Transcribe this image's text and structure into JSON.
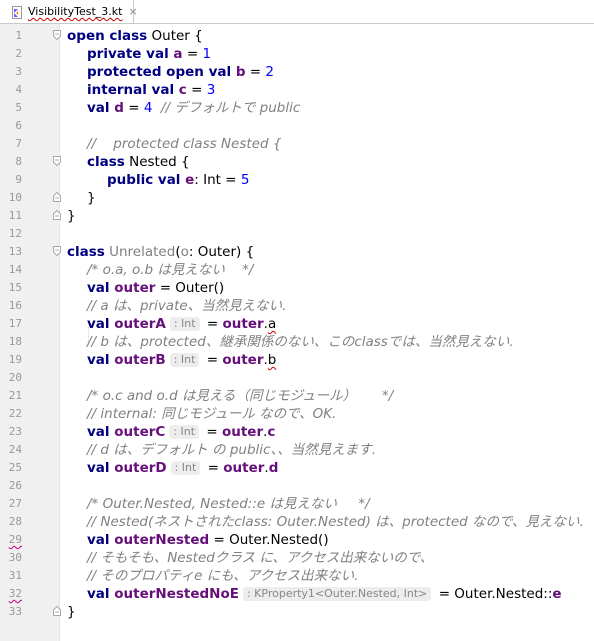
{
  "tab": {
    "title": "VisibilityTest_3.kt",
    "close": "×"
  },
  "editor": {
    "lines": [
      {
        "n": "1",
        "fold": "open",
        "indent": 0,
        "tokens": [
          {
            "t": "open class",
            "c": "kw"
          },
          {
            "t": " Outer {",
            "c": ""
          }
        ]
      },
      {
        "n": "2",
        "indent": 1,
        "tokens": [
          {
            "t": "private val",
            "c": "kw"
          },
          {
            "t": " a",
            "c": "prop"
          },
          {
            "t": " = ",
            "c": ""
          },
          {
            "t": "1",
            "c": "num"
          }
        ]
      },
      {
        "n": "3",
        "indent": 1,
        "tokens": [
          {
            "t": "protected open val",
            "c": "kw"
          },
          {
            "t": " b",
            "c": "prop"
          },
          {
            "t": " = ",
            "c": ""
          },
          {
            "t": "2",
            "c": "num"
          }
        ]
      },
      {
        "n": "4",
        "indent": 1,
        "tokens": [
          {
            "t": "internal val",
            "c": "kw"
          },
          {
            "t": " c",
            "c": "prop"
          },
          {
            "t": " = ",
            "c": ""
          },
          {
            "t": "3",
            "c": "num"
          }
        ]
      },
      {
        "n": "5",
        "indent": 1,
        "tokens": [
          {
            "t": "val",
            "c": "kw"
          },
          {
            "t": " d",
            "c": "prop"
          },
          {
            "t": " = ",
            "c": ""
          },
          {
            "t": "4",
            "c": "num"
          },
          {
            "t": "  // デフォルトで public",
            "c": "cmt"
          }
        ]
      },
      {
        "n": "6",
        "indent": 0,
        "tokens": []
      },
      {
        "n": "7",
        "indent": 1,
        "tokens": [
          {
            "t": "//    protected class Nested {",
            "c": "cmt"
          }
        ]
      },
      {
        "n": "8",
        "fold": "open",
        "indent": 1,
        "tokens": [
          {
            "t": "class",
            "c": "kw"
          },
          {
            "t": " Nested {",
            "c": ""
          }
        ]
      },
      {
        "n": "9",
        "indent": 2,
        "tokens": [
          {
            "t": "public val",
            "c": "kw"
          },
          {
            "t": " e",
            "c": "prop"
          },
          {
            "t": ": Int = ",
            "c": ""
          },
          {
            "t": "5",
            "c": "num"
          }
        ]
      },
      {
        "n": "10",
        "fold": "close",
        "indent": 1,
        "tokens": [
          {
            "t": "}",
            "c": ""
          }
        ]
      },
      {
        "n": "11",
        "fold": "close",
        "indent": 0,
        "tokens": [
          {
            "t": "}",
            "c": ""
          }
        ]
      },
      {
        "n": "12",
        "indent": 0,
        "tokens": []
      },
      {
        "n": "13",
        "fold": "open",
        "indent": 0,
        "tokens": [
          {
            "t": "class",
            "c": "kw"
          },
          {
            "t": " ",
            "c": ""
          },
          {
            "t": "Unrelated",
            "c": "gray"
          },
          {
            "t": "(",
            "c": ""
          },
          {
            "t": "o",
            "c": "gray"
          },
          {
            "t": ": Outer) {",
            "c": ""
          }
        ]
      },
      {
        "n": "14",
        "indent": 1,
        "tokens": [
          {
            "t": "/* o.a, o.b は見えない    */",
            "c": "cmt"
          }
        ]
      },
      {
        "n": "15",
        "indent": 1,
        "tokens": [
          {
            "t": "val",
            "c": "kw"
          },
          {
            "t": " outer",
            "c": "prop"
          },
          {
            "t": " = Outer()",
            "c": ""
          }
        ]
      },
      {
        "n": "16",
        "indent": 1,
        "tokens": [
          {
            "t": "// a は、private、当然見えない.",
            "c": "cmt"
          }
        ]
      },
      {
        "n": "17",
        "indent": 1,
        "tokens": [
          {
            "t": "val",
            "c": "kw"
          },
          {
            "t": " outerA",
            "c": "prop"
          },
          {
            "t": ": Int",
            "c": "hint"
          },
          {
            "t": " = ",
            "c": ""
          },
          {
            "t": "outer",
            "c": "prop"
          },
          {
            "t": ".",
            "c": ""
          },
          {
            "t": "a",
            "c": "warn"
          }
        ]
      },
      {
        "n": "18",
        "indent": 1,
        "tokens": [
          {
            "t": "// b は、protected、継承関係のない、このclassでは、当然見えない.",
            "c": "cmt"
          }
        ]
      },
      {
        "n": "19",
        "indent": 1,
        "tokens": [
          {
            "t": "val",
            "c": "kw"
          },
          {
            "t": " outerB",
            "c": "prop"
          },
          {
            "t": ": Int",
            "c": "hint"
          },
          {
            "t": " = ",
            "c": ""
          },
          {
            "t": "outer",
            "c": "prop"
          },
          {
            "t": ".",
            "c": ""
          },
          {
            "t": "b",
            "c": "warn"
          }
        ]
      },
      {
        "n": "20",
        "indent": 0,
        "tokens": []
      },
      {
        "n": "21",
        "indent": 1,
        "tokens": [
          {
            "t": "/* o.c and o.d は見える（同じモジュール）      */",
            "c": "cmt"
          }
        ]
      },
      {
        "n": "22",
        "indent": 1,
        "tokens": [
          {
            "t": "// internal: 同じモジュール なので、OK.",
            "c": "cmt"
          }
        ]
      },
      {
        "n": "23",
        "indent": 1,
        "tokens": [
          {
            "t": "val",
            "c": "kw"
          },
          {
            "t": " outerC",
            "c": "prop"
          },
          {
            "t": ": Int",
            "c": "hint"
          },
          {
            "t": " = ",
            "c": ""
          },
          {
            "t": "outer",
            "c": "prop"
          },
          {
            "t": ".",
            "c": ""
          },
          {
            "t": "c",
            "c": "prop"
          }
        ]
      },
      {
        "n": "24",
        "indent": 1,
        "tokens": [
          {
            "t": "// d は、デフォルト の public、、当然見えます.",
            "c": "cmt"
          }
        ]
      },
      {
        "n": "25",
        "indent": 1,
        "tokens": [
          {
            "t": "val",
            "c": "kw"
          },
          {
            "t": " outerD",
            "c": "prop"
          },
          {
            "t": ": Int",
            "c": "hint"
          },
          {
            "t": " = ",
            "c": ""
          },
          {
            "t": "outer",
            "c": "prop"
          },
          {
            "t": ".",
            "c": ""
          },
          {
            "t": "d",
            "c": "prop"
          }
        ]
      },
      {
        "n": "26",
        "indent": 0,
        "tokens": []
      },
      {
        "n": "27",
        "indent": 1,
        "tokens": [
          {
            "t": "/* Outer.Nested, Nested::e は見えない     */",
            "c": "cmt"
          }
        ]
      },
      {
        "n": "28",
        "indent": 1,
        "tokens": [
          {
            "t": "// Nested(ネストされたclass: Outer.Nested) は、protected なので、見えない.",
            "c": "cmt"
          }
        ]
      },
      {
        "n": "29",
        "err": true,
        "indent": 1,
        "tokens": [
          {
            "t": "val",
            "c": "kw"
          },
          {
            "t": " outerNested",
            "c": "prop"
          },
          {
            "t": " = Outer.Nested()",
            "c": ""
          }
        ]
      },
      {
        "n": "30",
        "indent": 1,
        "tokens": [
          {
            "t": "// そもそも、Nestedクラス に、アクセス出来ないので、",
            "c": "cmt"
          }
        ]
      },
      {
        "n": "31",
        "indent": 1,
        "tokens": [
          {
            "t": "// そのプロパティe にも、アクセス出来ない.",
            "c": "cmt"
          }
        ]
      },
      {
        "n": "32",
        "err": true,
        "indent": 1,
        "tokens": [
          {
            "t": "val",
            "c": "kw"
          },
          {
            "t": " outerNestedNoE",
            "c": "prop"
          },
          {
            "t": ": KProperty1<Outer.Nested, Int>",
            "c": "hint"
          },
          {
            "t": " = Outer.Nested::",
            "c": ""
          },
          {
            "t": "e",
            "c": "prop"
          }
        ]
      },
      {
        "n": "33",
        "fold": "close",
        "indent": 0,
        "tokens": [
          {
            "t": "}",
            "c": ""
          }
        ]
      }
    ]
  }
}
